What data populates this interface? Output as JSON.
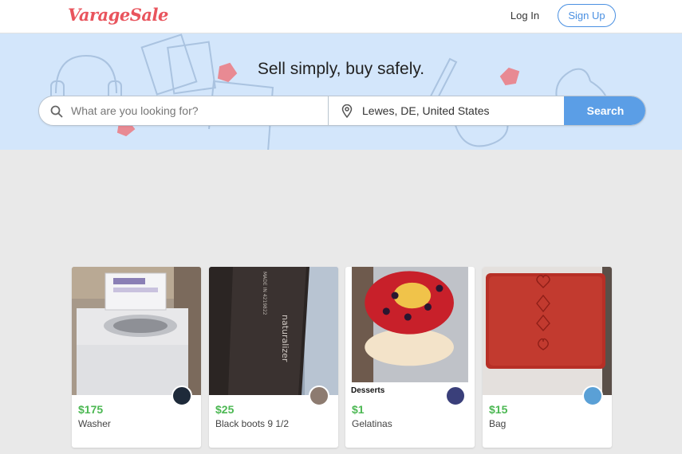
{
  "header": {
    "logo_text": "VarageSale",
    "login_label": "Log In",
    "signup_label": "Sign Up"
  },
  "hero": {
    "tagline": "Sell simply, buy safely.",
    "search_placeholder": "What are you looking for?",
    "location": "Lewes, DE, United States",
    "search_button": "Search"
  },
  "listings": [
    {
      "price": "$175",
      "title": "Washer",
      "category": ""
    },
    {
      "price": "$25",
      "title": "Black boots 9 1/2",
      "category": ""
    },
    {
      "price": "$1",
      "title": "Gelatinas",
      "category": "Desserts"
    },
    {
      "price": "$15",
      "title": "Bag",
      "category": ""
    }
  ],
  "colors": {
    "brand": "#e9545d",
    "accent": "#5b9ee6",
    "price": "#4cb853",
    "hero_bg": "#d3e6fb"
  }
}
